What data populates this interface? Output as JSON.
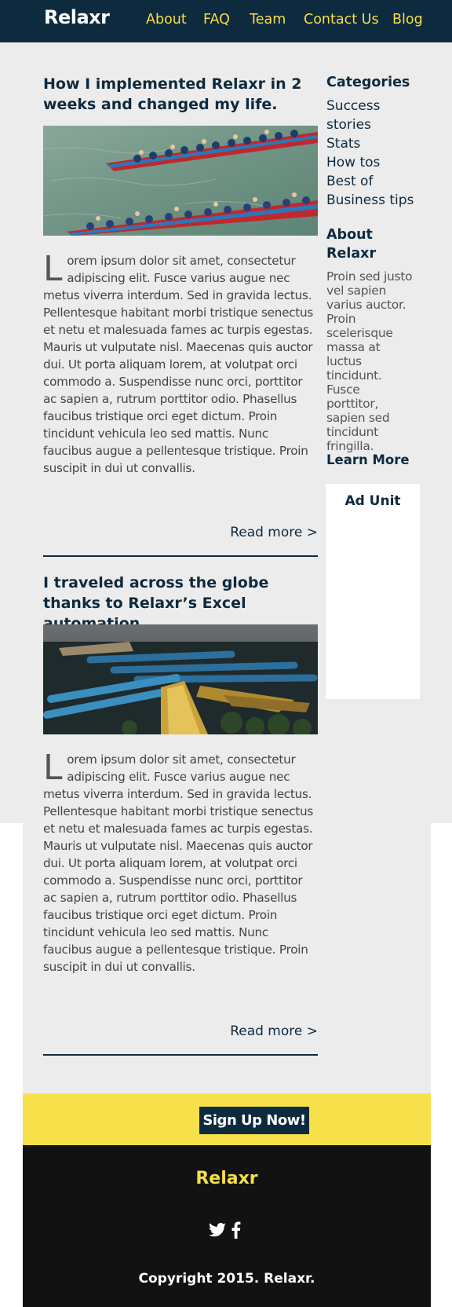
{
  "header": {
    "logo": "Relaxr",
    "nav": [
      "About",
      "FAQ",
      "Team",
      "Contact Us",
      "Blog"
    ]
  },
  "posts": [
    {
      "title": "How I implemented Relaxr in 2 weeks and changed my life.",
      "image": "dragon-boat-race-photo",
      "dropcap": "L",
      "body": "orem ipsum dolor sit amet, consectetur adipiscing elit. Fusce varius augue nec metus viverra interdum. Sed in gravida lectus. Pellentesque habitant morbi tristique senectus et netu et malesuada fames ac turpis egestas. Mauris ut vulputate nisl. Maecenas quis auctor dui. Ut porta aliquam lorem, at volutpat orci commodo a. Suspendisse nunc orci, porttitor ac sapien a, rutrum porttitor odio. Phasellus faucibus tristique orci eget dictum. Proin tincidunt vehicula leo sed mattis. Nunc faucibus augue a pellentesque tristique. Proin suscipit in dui ut convallis.",
      "read_more": "Read more >"
    },
    {
      "title": "I traveled across the globe thanks to Relaxr’s Excel automation",
      "image": "moored-boats-lake-photo",
      "dropcap": "L",
      "body": "orem ipsum dolor sit amet, consectetur adipiscing elit. Fusce varius augue nec metus viverra interdum. Sed in gravida lectus. Pellentesque habitant morbi tristique senectus et netu et malesuada fames ac turpis egestas. Mauris ut vulputate nisl. Maecenas quis auctor dui. Ut porta aliquam lorem, at volutpat orci commodo a. Suspendisse nunc orci, porttitor ac sapien a, rutrum porttitor odio. Phasellus faucibus tristique orci eget dictum. Proin tincidunt vehicula leo sed mattis. Nunc faucibus augue a pellentesque tristique. Proin suscipit in dui ut convallis.",
      "read_more": "Read more >"
    }
  ],
  "sidebar": {
    "categories_heading": "Categories",
    "categories": [
      "Success stories",
      "Stats",
      "How tos",
      "Best of",
      "Business tips"
    ],
    "about_heading": "About Relaxr",
    "about_text": "Proin sed justo vel sapien varius auctor. Proin scelerisque massa at luctus tincidunt. Fusce porttitor, sapien sed tincidunt fringilla.",
    "learn_more": "Learn More",
    "ad_label": "Ad Unit"
  },
  "signup": {
    "button": "Sign Up Now!"
  },
  "footer": {
    "logo": "Relaxr",
    "social": [
      "twitter-icon",
      "facebook-icon"
    ],
    "copyright": "Copyright 2015. Relaxr."
  },
  "colors": {
    "navy": "#0e2a3e",
    "yellow": "#f7e04a",
    "light_gray": "#ececec",
    "footer_black": "#121212"
  }
}
